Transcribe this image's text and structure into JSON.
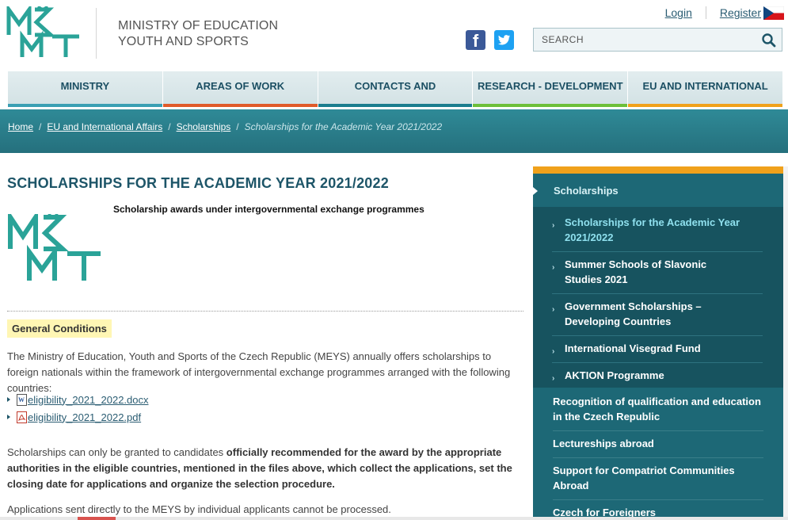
{
  "header": {
    "ministry_line1": "MINISTRY OF EDUCATION",
    "ministry_line2": "YOUTH AND SPORTS",
    "login": "Login",
    "register": "Register",
    "search_placeholder": "SEARCH",
    "icons": {
      "facebook": "facebook-icon",
      "twitter": "twitter-icon",
      "search": "search-icon",
      "flag": "czech-flag-icon"
    }
  },
  "nav": {
    "items": [
      {
        "label": "MINISTRY",
        "color": "#3a9fb3"
      },
      {
        "label": "AREAS OF WORK",
        "color": "#e05a2a"
      },
      {
        "label": "CONTACTS AND INFORMATION",
        "color": "#1b7d8e"
      },
      {
        "label": "RESEARCH - DEVELOPMENT",
        "color": "#6cbf3a"
      },
      {
        "label": "EU AND INTERNATIONAL AFFAIRS",
        "color": "#f0a11b"
      }
    ]
  },
  "breadcrumb": {
    "home": "Home",
    "eu": "EU and International Affairs",
    "scholarships": "Scholarships",
    "current": "Scholarships for the Academic Year 2021/2022"
  },
  "main": {
    "title": "SCHOLARSHIPS FOR THE ACADEMIC YEAR 2021/2022",
    "subtitle": "Scholarship awards under intergovernmental exchange programmes",
    "general_conditions": "General Conditions",
    "p1": "The Ministry of Education, Youth and Sports of the Czech Republic (MEYS) annually offers scholarships to foreign nationals within the framework of intergovernmental exchange programmes arranged with the following countries:",
    "files": [
      {
        "name": "eligibility_2021_2022.docx",
        "type": "word-doc-icon"
      },
      {
        "name": "eligibility_2021_2022.pdf",
        "type": "pdf-icon"
      }
    ],
    "p2_start": "Scholarships can only be granted to candidates ",
    "p2_bold": "officially recommended for the award by the appropriate authorities in the eligible countries, mentioned in the files above, which collect the applications, set the closing date for applications and organize the selection procedure.",
    "p3": "Applications sent directly to the MEYS by individual applicants cannot be processed."
  },
  "sidebar": {
    "heading": "Scholarships",
    "sub_items": [
      {
        "line1": "Scholarships for the Academic Year",
        "line2": "2021/2022"
      },
      {
        "line1": "Summer Schools of Slavonic",
        "line2": "Studies 2021"
      },
      {
        "line1": "Government Scholarships –",
        "line2": "Developing Countries"
      },
      {
        "line1": "International Visegrad Fund"
      },
      {
        "line1": "AKTION Programme"
      }
    ],
    "main_items": [
      {
        "line1": "Recognition of qualification and education",
        "line2": "in the Czech Republic"
      },
      {
        "line1": "Lectureships abroad"
      },
      {
        "line1": "Support for Compatriot Communities",
        "line2": "Abroad"
      },
      {
        "line1": "Czech for Foreigners"
      }
    ]
  }
}
